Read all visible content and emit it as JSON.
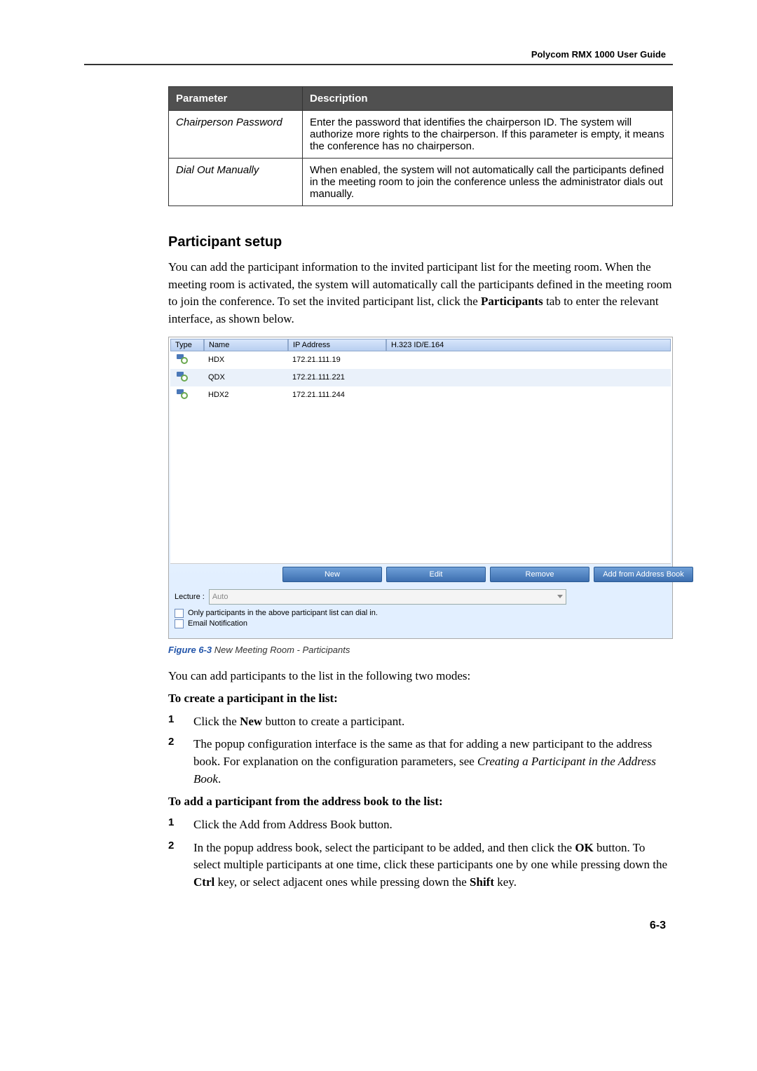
{
  "header": {
    "guide_title": "Polycom RMX 1000 User Guide"
  },
  "param_table": {
    "headers": {
      "parameter": "Parameter",
      "description": "Description"
    },
    "rows": [
      {
        "param": "Chairperson Password",
        "desc": "Enter the password that identifies the chairperson ID. The system will authorize more rights to the chairperson. If this parameter is empty, it means the conference has no chairperson."
      },
      {
        "param": "Dial Out Manually",
        "desc": "When enabled, the system will not automatically call the participants defined in the meeting room to join the conference unless the administrator dials out manually."
      }
    ]
  },
  "section": {
    "title": "Participant setup",
    "intro_pre": "You can add the participant information to the invited participant list for the meeting room. When the meeting room is activated, the system will automatically call the participants defined in the meeting room to join the conference. To set the invited participant list, click the ",
    "intro_bold": "Participants",
    "intro_post": " tab to enter the relevant interface, as shown below."
  },
  "figure": {
    "headers": {
      "type": "Type",
      "name": "Name",
      "ip": "IP Address",
      "h323": "H.323 ID/E.164"
    },
    "rows": [
      {
        "name": "HDX",
        "ip": "172.21.111.19"
      },
      {
        "name": "QDX",
        "ip": "172.21.111.221"
      },
      {
        "name": "HDX2",
        "ip": "172.21.111.244"
      }
    ],
    "buttons": {
      "new": "New",
      "edit": "Edit",
      "remove": "Remove",
      "addr": "Add from Address Book"
    },
    "lecture_label": "Lecture :",
    "lecture_value": "Auto",
    "check1": "Only participants in the above participant list can dial in.",
    "check2": "Email Notification",
    "caption_num": "Figure 6-3",
    "caption_text": " New Meeting Room - Participants"
  },
  "after_figure": {
    "p1": "You can add participants to the list in the following two modes:",
    "h1": "To create a participant in the list:",
    "list1": {
      "i1_pre": "Click the ",
      "i1_bold": "New",
      "i1_post": " button to create a participant.",
      "i2_pre": "The popup configuration interface is the same as that for adding a new participant to the address book. For explanation on the configuration parameters, see ",
      "i2_italic": "Creating a Participant in the Address Book",
      "i2_post": "."
    },
    "h2": "To add a participant from the address book to the list:",
    "list2": {
      "i1": "Click the Add from Address Book button.",
      "i2_pre": "In the popup address book, select the participant to be added, and then click the ",
      "i2_b1": "OK",
      "i2_mid1": " button. To select multiple participants at one time, click these participants one by one while pressing down the ",
      "i2_b2": "Ctrl",
      "i2_mid2": " key, or select adjacent ones while pressing down the ",
      "i2_b3": "Shift",
      "i2_end": " key."
    }
  },
  "page_number": "6-3"
}
